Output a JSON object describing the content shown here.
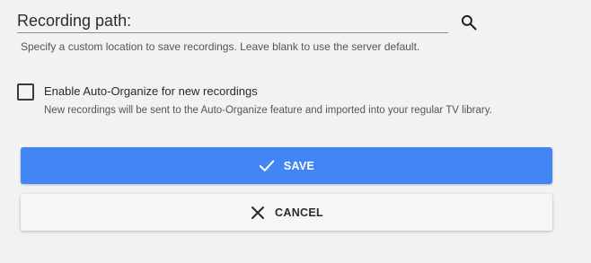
{
  "recording_path": {
    "placeholder": "Recording path:",
    "value": "",
    "help_text": "Specify a custom location to save recordings. Leave blank to use the server default."
  },
  "auto_organize": {
    "label": "Enable Auto-Organize for new recordings",
    "help_text": "New recordings will be sent to the Auto-Organize feature and imported into your regular TV library.",
    "checked": false
  },
  "buttons": {
    "save_label": "SAVE",
    "save_icon": "check-icon",
    "cancel_label": "CANCEL",
    "cancel_icon": "close-icon"
  },
  "colors": {
    "save_button": "#4285f4",
    "cancel_button": "#f6f6f6",
    "background": "#f2f2f2"
  }
}
